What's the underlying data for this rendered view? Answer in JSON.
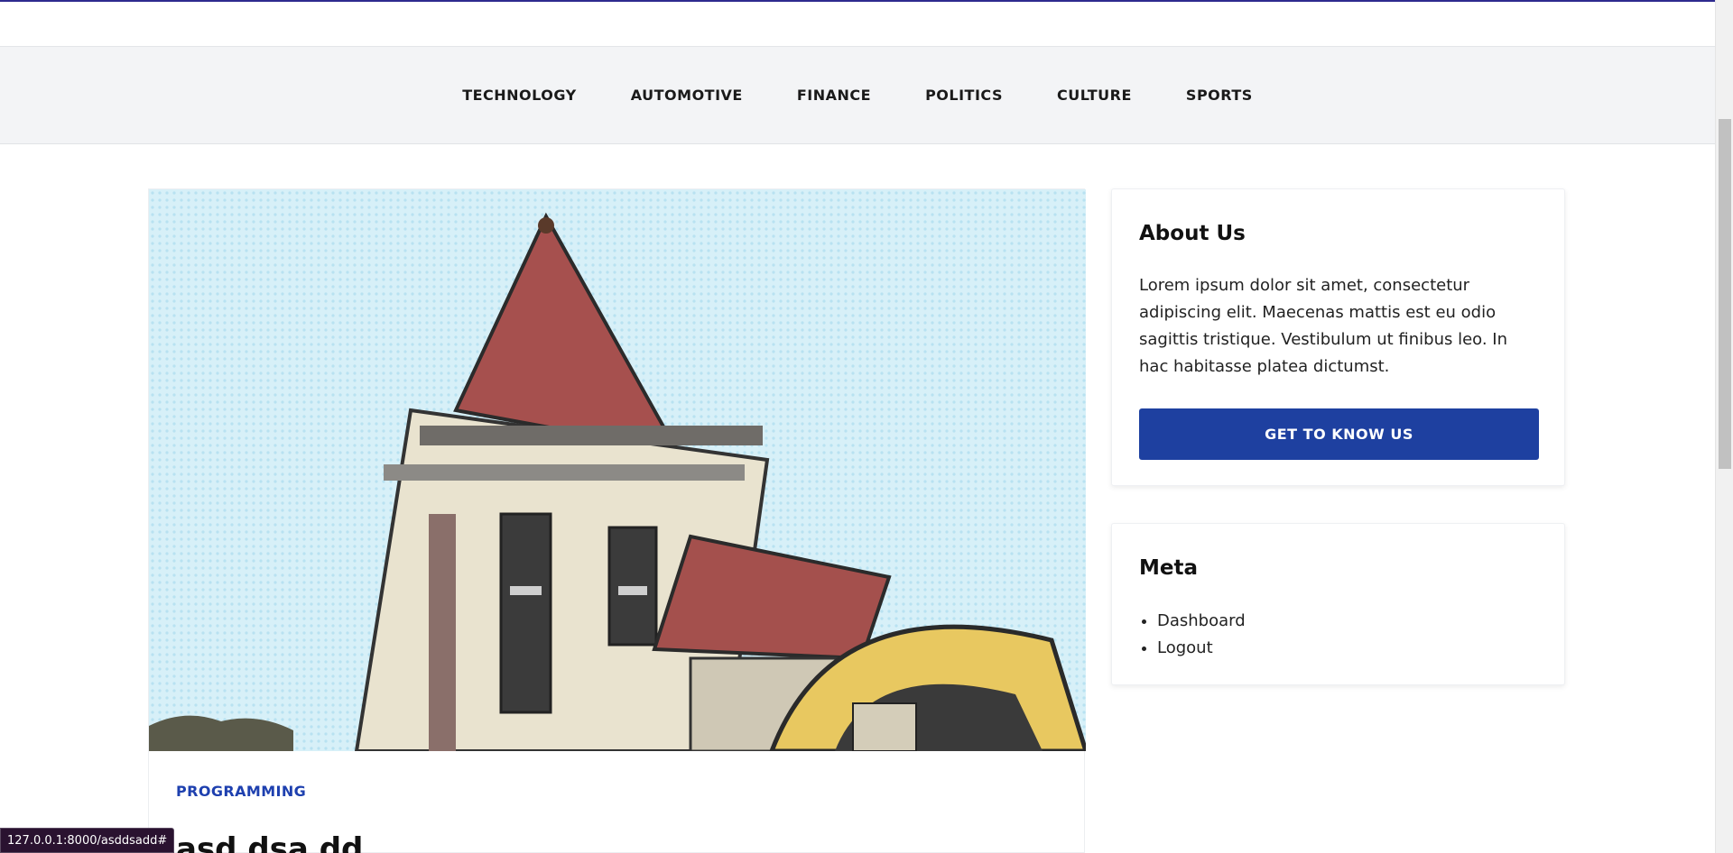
{
  "nav": {
    "items": [
      "TECHNOLOGY",
      "AUTOMOTIVE",
      "FINANCE",
      "POLITICS",
      "CULTURE",
      "SPORTS"
    ]
  },
  "article": {
    "category": "PROGRAMMING",
    "title": "asd dsa dd",
    "image_alt": "building-photo"
  },
  "sidebar": {
    "about": {
      "title": "About Us",
      "text": "Lorem ipsum dolor sit amet, consectetur adipiscing elit. Maecenas mattis est eu odio sagittis tristique. Vestibulum ut finibus leo. In hac habitasse platea dictumst.",
      "button_label": "GET TO KNOW US"
    },
    "meta": {
      "title": "Meta",
      "links": [
        "Dashboard",
        "Logout"
      ]
    }
  },
  "status_bar": {
    "url": "127.0.0.1:8000/asddsadd#"
  },
  "colors": {
    "accent": "#1e40a0",
    "category": "#1e40af",
    "nav_bg": "#f3f4f6"
  }
}
